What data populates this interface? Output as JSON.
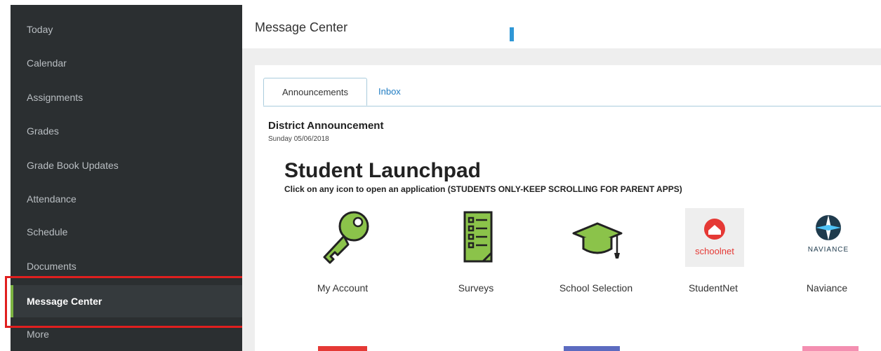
{
  "sidebar": {
    "items": [
      {
        "label": "Today"
      },
      {
        "label": "Calendar"
      },
      {
        "label": "Assignments"
      },
      {
        "label": "Grades"
      },
      {
        "label": "Grade Book Updates"
      },
      {
        "label": "Attendance"
      },
      {
        "label": "Schedule"
      },
      {
        "label": "Documents"
      },
      {
        "label": "Message Center",
        "active": true
      },
      {
        "label": "More"
      }
    ]
  },
  "header": {
    "title": "Message Center"
  },
  "tabs": [
    {
      "label": "Announcements",
      "active": true
    },
    {
      "label": "Inbox",
      "active": false
    }
  ],
  "announcement": {
    "title": "District Announcement",
    "date": "Sunday 05/06/2018"
  },
  "launchpad": {
    "title": "Student Launchpad",
    "subtitle": "Click on any icon to open an application (STUDENTS ONLY-KEEP SCROLLING FOR PARENT APPS)",
    "apps": [
      {
        "label": "My Account",
        "icon": "key-icon"
      },
      {
        "label": "Surveys",
        "icon": "checklist-icon"
      },
      {
        "label": "School Selection",
        "icon": "graduation-cap-icon"
      },
      {
        "label": "StudentNet",
        "icon": "schoolnet-logo",
        "logo_text": "schoolnet"
      },
      {
        "label": "Naviance",
        "icon": "naviance-logo",
        "logo_text": "NAVIANCE"
      }
    ]
  },
  "colors": {
    "sidebar_bg": "#2b2f31",
    "active_accent": "#7cb342",
    "highlight": "#e01f1f",
    "link_blue": "#1e7bc2"
  }
}
